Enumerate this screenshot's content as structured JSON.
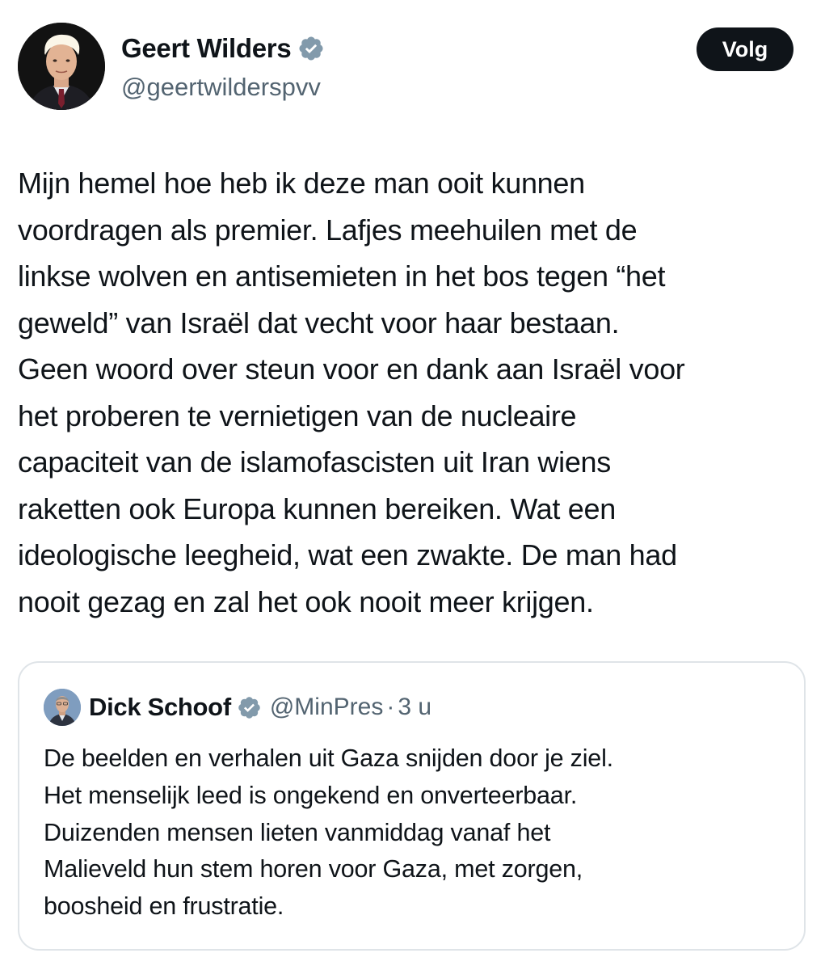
{
  "tweet": {
    "author": {
      "name": "Geert Wilders",
      "handle": "@geertwilderspvv",
      "verified": true,
      "avatar_icon": "profile-photo"
    },
    "follow_label": "Volg",
    "text_lines": [
      "Mijn hemel hoe heb ik deze man ooit kunnen",
      "voordragen als premier. Lafjes meehuilen met de",
      "linkse wolven en antisemieten in het bos tegen “het",
      "geweld” van Israël dat vecht voor haar bestaan.",
      "Geen woord over steun voor en dank aan Israël voor",
      "het proberen te vernietigen van de nucleaire",
      "capaciteit van de islamofascisten uit Iran wiens",
      "raketten ook Europa kunnen bereiken. Wat een",
      "ideologische leegheid, wat een zwakte. De man had",
      "nooit gezag en zal het ook nooit meer krijgen."
    ]
  },
  "quote": {
    "author": {
      "name": "Dick Schoof",
      "handle": "@MinPres",
      "verified": true,
      "avatar_icon": "profile-photo"
    },
    "separator": "·",
    "time": "3 u",
    "text_lines": [
      "De beelden en verhalen uit Gaza snijden door je ziel.",
      "Het menselijk leed is ongekend en onverteerbaar.",
      "Duizenden mensen lieten vanmiddag vanaf het",
      "Malieveld hun stem horen voor Gaza, met zorgen,",
      "boosheid en frustratie."
    ]
  },
  "colors": {
    "text": "#0f1419",
    "secondary_text": "#536471",
    "verified_badge": "#829aab",
    "button_bg": "#0f1419",
    "button_text": "#ffffff",
    "card_border": "#dfe4e8"
  }
}
